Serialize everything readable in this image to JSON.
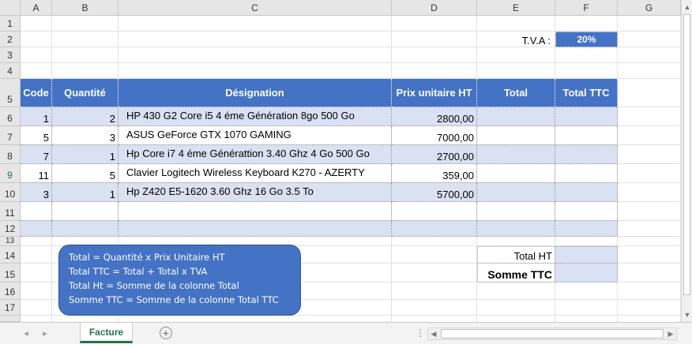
{
  "columns": [
    "A",
    "B",
    "C",
    "D",
    "E",
    "F",
    "G"
  ],
  "rows": [
    "1",
    "2",
    "3",
    "4",
    "5",
    "6",
    "7",
    "8",
    "9",
    "10",
    "11",
    "12",
    "13",
    "14",
    "15",
    "16",
    "17"
  ],
  "tva": {
    "label": "T.V.A :",
    "value": "20%"
  },
  "table": {
    "headers": [
      "Code",
      "Quantité",
      "Désignation",
      "Prix unitaire HT",
      "Total",
      "Total TTC"
    ],
    "rows": [
      {
        "code": "1",
        "qty": "2",
        "designation": "HP 430 G2 Core i5 4 éme Génération 8go 500 Go",
        "price": "2800,00"
      },
      {
        "code": "5",
        "qty": "3",
        "designation": "ASUS GeForce GTX 1070 GAMING",
        "price": "7000,00"
      },
      {
        "code": "7",
        "qty": "1",
        "designation": "Hp Core i7 4 éme Générattion 3.40 Ghz 4 Go 500 Go",
        "price": "2700,00"
      },
      {
        "code": "11",
        "qty": "5",
        "designation": "Clavier Logitech Wireless Keyboard K270 - AZERTY",
        "price": "359,00"
      },
      {
        "code": "3",
        "qty": "1",
        "designation": "Hp Z420 E5-1620 3.60 Ghz 16 Go 3.5 To",
        "price": "5700,00"
      }
    ]
  },
  "totals": {
    "total_ht_label": "Total HT",
    "somme_ttc_label": "Somme TTC"
  },
  "note": {
    "lines": [
      "Total = Quantité x Prix Unitaire HT",
      "Total TTC = Total + Total x TVA",
      "Total Ht = Somme de la colonne Total",
      "Somme TTC = Somme de la colonne Total TTC"
    ]
  },
  "sheet_tab": "Facture",
  "colors": {
    "header_blue": "#4472c4",
    "band": "#d9e1f2",
    "excel_green": "#217346"
  }
}
